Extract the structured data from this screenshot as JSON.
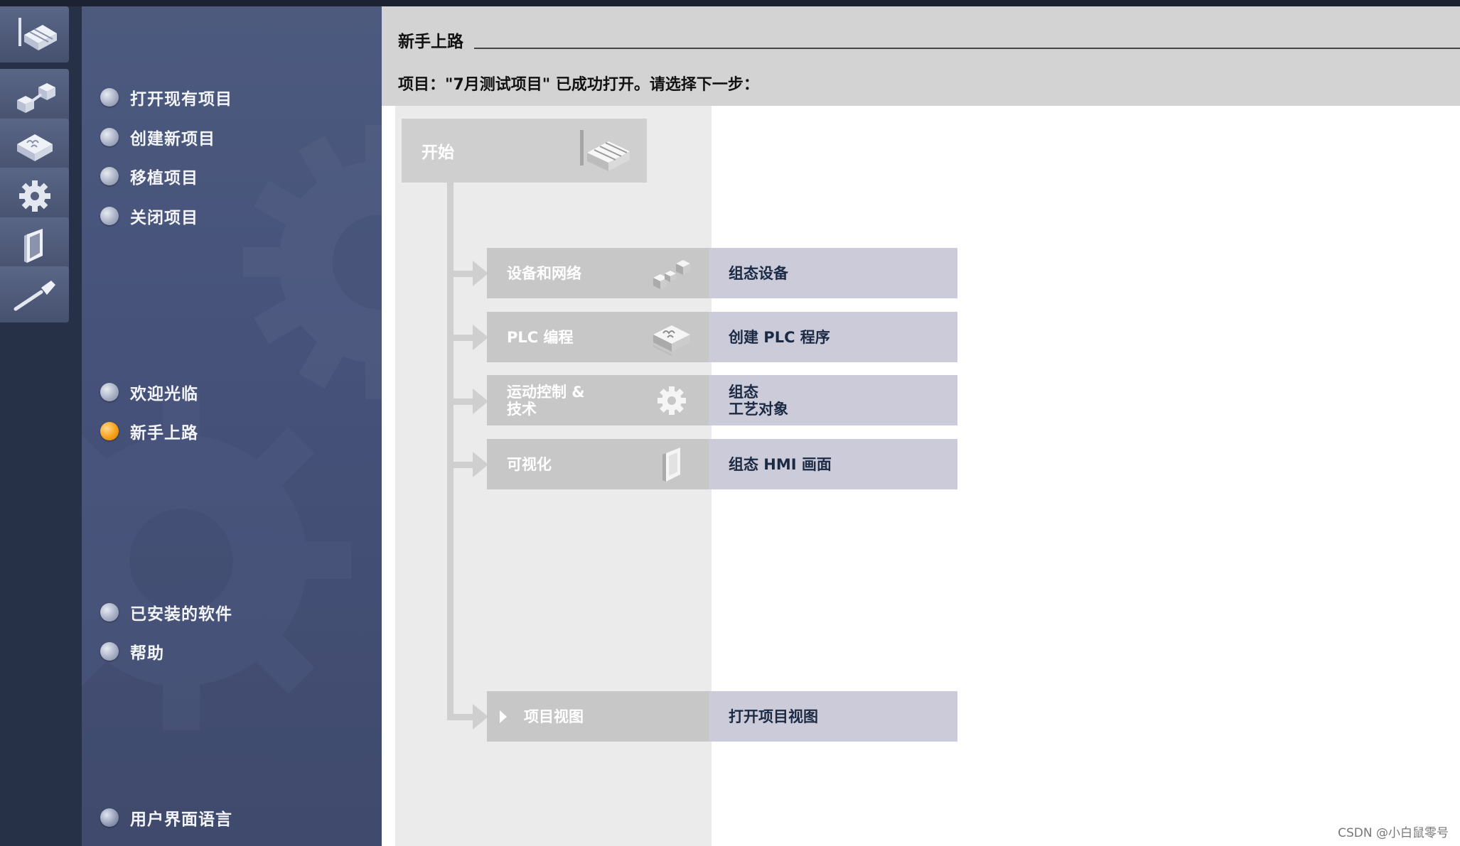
{
  "rail": {
    "items": [
      {
        "icon": "start-portal-icon"
      },
      {
        "icon": "devices-networks-icon"
      },
      {
        "icon": "plc-programming-icon"
      },
      {
        "icon": "motion-technology-icon"
      },
      {
        "icon": "visualization-icon"
      },
      {
        "icon": "online-diagnostics-icon"
      }
    ]
  },
  "nav": {
    "open_existing": "打开现有项目",
    "create_new": "创建新项目",
    "migrate": "移植项目",
    "close": "关闭项目",
    "welcome": "欢迎光临",
    "first_steps": "新手上路",
    "installed_software": "已安装的软件",
    "help": "帮助",
    "ui_language": "用户界面语言"
  },
  "main": {
    "title": "新手上路",
    "status": "项目：\"7月测试项目\" 已成功打开。请选择下一步：",
    "start": "开始",
    "rows": [
      {
        "label": "设备和网络",
        "action": "组态设备"
      },
      {
        "label": "PLC 编程",
        "action": "创建 PLC 程序"
      },
      {
        "label": "运动控制 &\n技术",
        "action": "组态\n工艺对象"
      },
      {
        "label": "可视化",
        "action": "组态 HMI 画面"
      },
      {
        "label": "项目视图",
        "action": "打开项目视图"
      }
    ]
  },
  "watermark": "CSDN @小白鼠零号",
  "colors": {
    "accent_active": "#f7a11a",
    "nav_panel": "#4a5679",
    "header_gray": "#d3d3d3",
    "action_panel": "#cbcbd9"
  }
}
